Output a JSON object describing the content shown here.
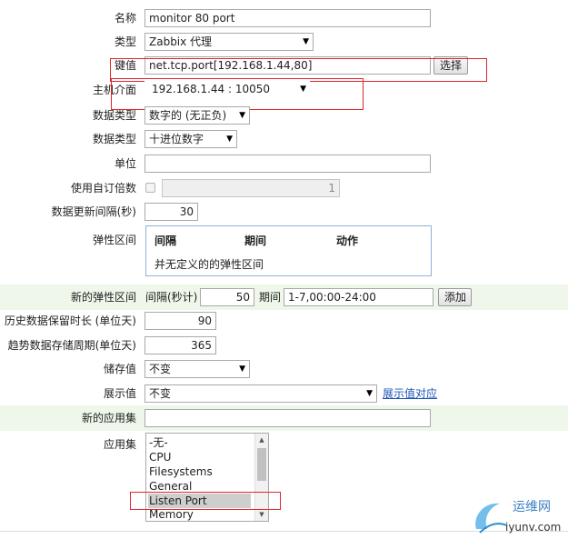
{
  "form": {
    "name": {
      "label": "名称",
      "value": "monitor 80 port"
    },
    "type": {
      "label": "类型",
      "value": "Zabbix 代理"
    },
    "key": {
      "label": "键值",
      "value": "net.tcp.port[192.168.1.44,80]",
      "button": "选择"
    },
    "host_interface": {
      "label": "主机介面",
      "value": "192.168.1.44 : 10050"
    },
    "data_type1": {
      "label": "数据类型",
      "value": "数字的 (无正负)"
    },
    "data_type2": {
      "label": "数据类型",
      "value": "十进位数字"
    },
    "units": {
      "label": "单位",
      "value": ""
    },
    "custom_multiplier": {
      "label": "使用自订倍数",
      "value": "1"
    },
    "update_interval": {
      "label": "数据更新间隔(秒)",
      "value": "30"
    },
    "flexible_intervals": {
      "label": "弹性区间",
      "columns": [
        "间隔",
        "期间",
        "动作"
      ],
      "empty_text": "并无定义的的弹性区间"
    },
    "new_flexible": {
      "label": "新的弹性区间",
      "interval_label": "间隔(秒计)",
      "interval_value": "50",
      "period_label": "期间",
      "period_value": "1-7,00:00-24:00",
      "add_button": "添加"
    },
    "history": {
      "label": "历史数据保留时长 (单位天)",
      "value": "90"
    },
    "trends": {
      "label": "趋势数据存储周期(单位天)",
      "value": "365"
    },
    "store_value": {
      "label": "储存值",
      "value": "不变"
    },
    "show_value": {
      "label": "展示值",
      "value": "不变",
      "link": "展示值对应"
    },
    "new_application": {
      "label": "新的应用集",
      "value": ""
    },
    "applications": {
      "label": "应用集",
      "options": [
        "-无-",
        "CPU",
        "Filesystems",
        "General",
        "Listen Port",
        "Memory"
      ],
      "selected": "Listen Port"
    }
  },
  "watermark": {
    "text": "运维网",
    "url": "iyunv.com"
  },
  "colors": {
    "highlight_box": "#e0262c",
    "alt_row": "#eef7ea",
    "link": "#1d54b8"
  }
}
